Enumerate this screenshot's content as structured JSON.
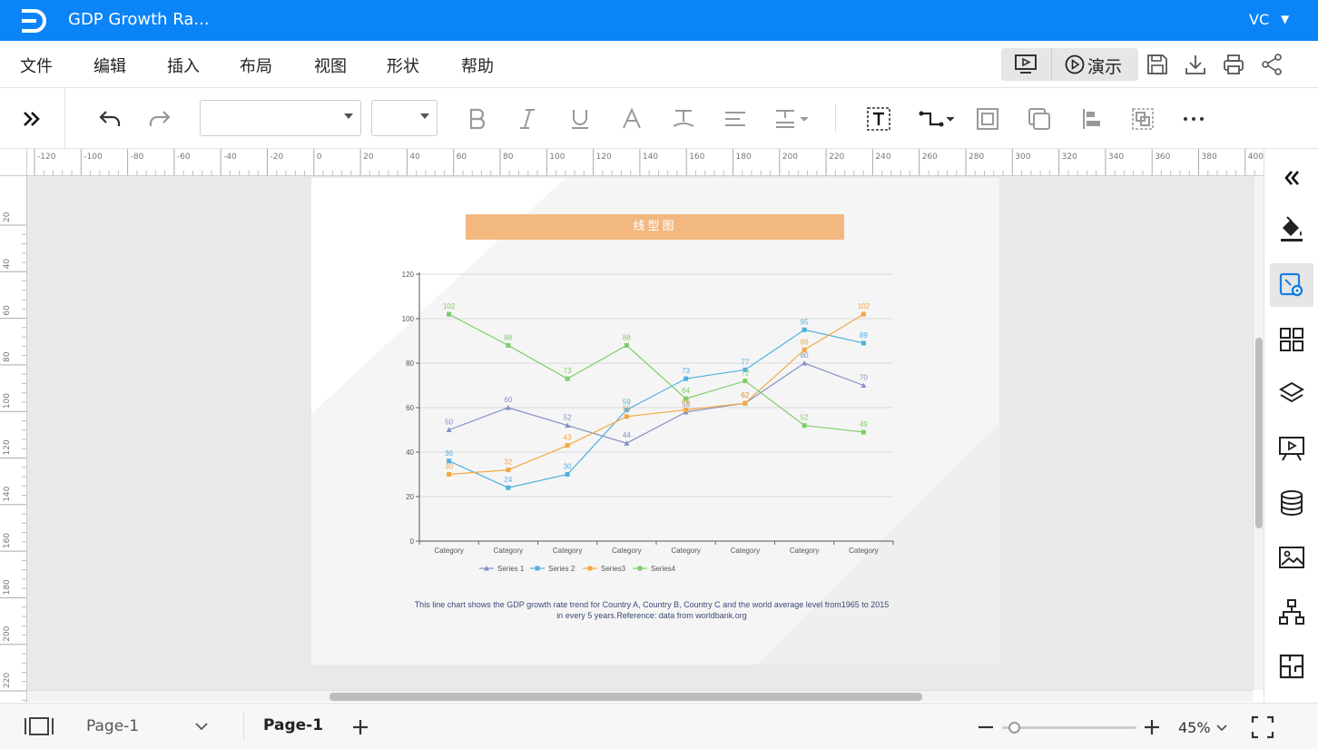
{
  "app": {
    "document_title": "GDP Growth Ra...",
    "user": "VC"
  },
  "menu": {
    "items": [
      "文件",
      "编辑",
      "插入",
      "布局",
      "视图",
      "形状",
      "帮助"
    ],
    "present_label": "演示"
  },
  "ruler": {
    "horizontal_ticks": [
      "-120",
      "-100",
      "-80",
      "-60",
      "-40",
      "-20",
      "0",
      "20",
      "40",
      "60",
      "80",
      "100",
      "120",
      "140",
      "160",
      "180",
      "200",
      "220",
      "240",
      "260",
      "280",
      "300",
      "320",
      "340",
      "360",
      "380",
      "400"
    ],
    "vertical_ticks": [
      "20",
      "40",
      "60",
      "80",
      "100",
      "120",
      "140",
      "160",
      "180",
      "200",
      "220"
    ]
  },
  "chart_header": "线型图",
  "chart_description": "This line chart shows the GDP growth rate trend for Country A, Country B, Country C and the world average level from1965 to 2015 in every 5 years.Reference: data from worldbank.org",
  "chart_data": {
    "type": "line",
    "categories": [
      "Category",
      "Category",
      "Category",
      "Category",
      "Category",
      "Category",
      "Category",
      "Category"
    ],
    "ylim": [
      0,
      120
    ],
    "yticks": [
      "0",
      "20",
      "40",
      "60",
      "80",
      "100",
      "120"
    ],
    "grid": true,
    "legend_position": "bottom",
    "series": [
      {
        "name": "Series 1",
        "color": "#8091c3",
        "marker": "triangle",
        "values": [
          50,
          60,
          52,
          44,
          58,
          62,
          80,
          70
        ]
      },
      {
        "name": "Series 2",
        "color": "#4fb0e0",
        "marker": "square",
        "values": [
          36,
          24,
          30,
          59,
          73,
          77,
          95,
          89
        ]
      },
      {
        "name": "Series3",
        "color": "#f3a843",
        "marker": "square",
        "values": [
          30,
          32,
          43,
          56,
          59,
          62,
          86,
          102
        ]
      },
      {
        "name": "Series4",
        "color": "#7fcc6a",
        "marker": "square",
        "values": [
          102,
          88,
          73,
          88,
          64,
          72,
          52,
          49
        ]
      }
    ]
  },
  "status": {
    "page_selector": "Page-1",
    "active_page_tab": "Page-1",
    "zoom": "45%",
    "zoom_fraction": 0.09
  },
  "colors": {
    "title_bar": "#0b84f8",
    "chart_header": "#f2b880",
    "active_sidebar_icon": "#1a7fe0"
  }
}
